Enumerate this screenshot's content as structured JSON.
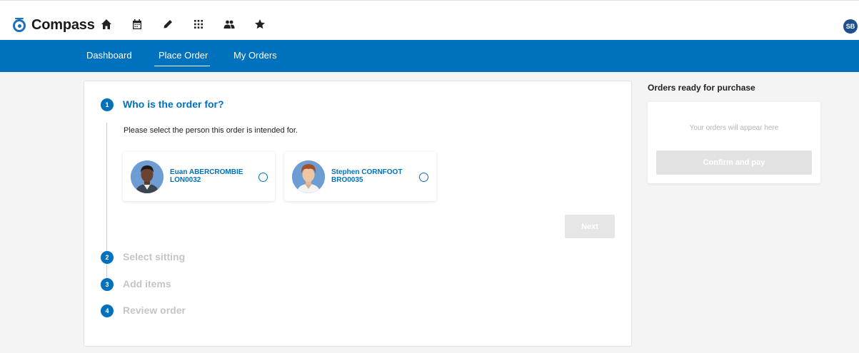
{
  "brand": {
    "name": "Compass",
    "color": "#0071bc"
  },
  "header": {
    "icons": [
      "home-icon",
      "calendar-icon",
      "pencil-icon",
      "grid-icon",
      "users-icon",
      "star-icon"
    ],
    "user_initials": "SB"
  },
  "nav": {
    "tabs": [
      {
        "label": "Dashboard",
        "active": false
      },
      {
        "label": "Place Order",
        "active": true
      },
      {
        "label": "My Orders",
        "active": false
      }
    ]
  },
  "wizard": {
    "steps": [
      {
        "number": "1",
        "title": "Who is the order for?",
        "active": true
      },
      {
        "number": "2",
        "title": "Select sitting",
        "active": false
      },
      {
        "number": "3",
        "title": "Add items",
        "active": false
      },
      {
        "number": "4",
        "title": "Review order",
        "active": false
      }
    ],
    "instruction": "Please select the person this order is intended for.",
    "people": [
      {
        "name": "Euan ABERCROMBIE",
        "id": "LON0032",
        "selected": false
      },
      {
        "name": "Stephen CORNFOOT",
        "id": "BRO0035",
        "selected": false
      }
    ],
    "next_label": "Next"
  },
  "orders": {
    "heading": "Orders ready for purchase",
    "empty_text": "Your orders will appear here",
    "confirm_label": "Confirm and pay"
  }
}
